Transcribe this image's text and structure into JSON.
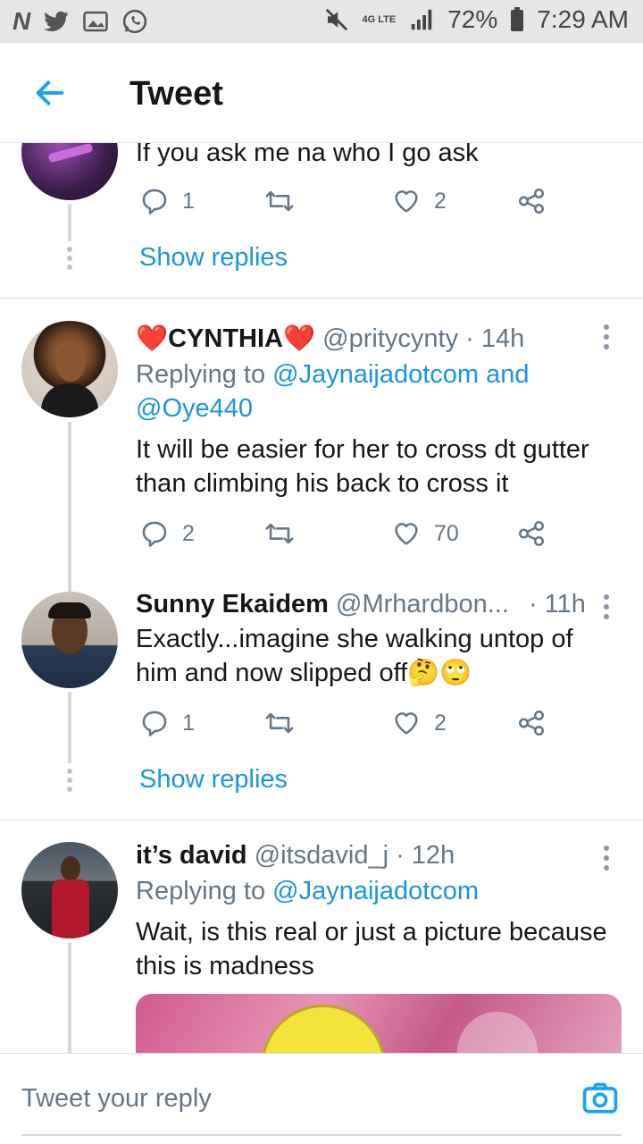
{
  "status_bar": {
    "left_icons": [
      "netflix-n-icon",
      "twitter-icon",
      "gallery-icon",
      "whatsapp-icon"
    ],
    "network": "4G LTE",
    "battery": "72%",
    "time": "7:29 AM"
  },
  "header": {
    "title": "Tweet"
  },
  "tweets": [
    {
      "text": "If you ask me na who I go ask",
      "replies": "1",
      "retweets": "",
      "likes": "2",
      "show_replies": "Show replies"
    },
    {
      "name": "❤️CYNTHIA❤️",
      "handle": "@pritycynty",
      "time": "· 14h",
      "replying_prefix": "Replying to",
      "replying_to_1": "@Jaynaijadotcom",
      "replying_and": "and",
      "replying_to_2": "@Oye440",
      "text_line1": "It will be easier for her to cross dt gutter",
      "text_line2": "than climbing his back to cross it",
      "replies": "2",
      "likes": "70"
    },
    {
      "name": "Sunny Ekaidem",
      "handle": "@Mrhardbon...",
      "time": "· 11h",
      "text_line1": "Exactly...imagine she walking untop of",
      "text_line2": "him and now slipped off🤔🙄",
      "replies": "1",
      "likes": "2",
      "show_replies": "Show replies"
    },
    {
      "name": "it’s david",
      "handle": "@itsdavid_j",
      "time": "· 12h",
      "replying_prefix": "Replying to",
      "replying_to_1": "@Jaynaijadotcom",
      "text_line1": "Wait, is this real or just a picture because",
      "text_line2": "this is madness"
    }
  ],
  "reply_bar": {
    "placeholder": "Tweet your reply"
  },
  "colors": {
    "link": "#1b95e0",
    "muted": "#657786",
    "divider": "#d8dee2"
  }
}
